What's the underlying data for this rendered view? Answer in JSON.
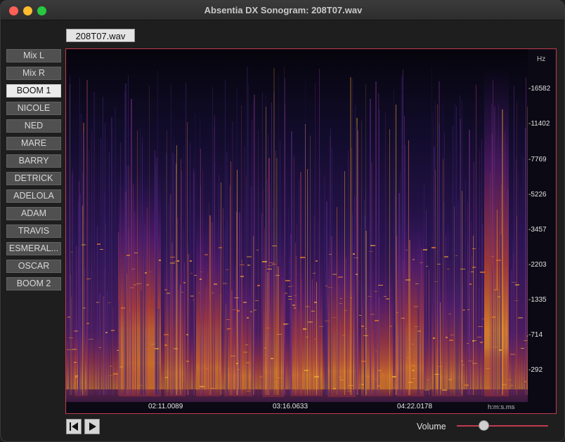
{
  "window": {
    "title": "Absentia DX Sonogram: 208T07.wav"
  },
  "file_tab": {
    "label": "208T07.wav"
  },
  "tracks": [
    {
      "label": "Mix L"
    },
    {
      "label": "Mix R"
    },
    {
      "label": "BOOM 1",
      "selected": true
    },
    {
      "label": "NICOLE"
    },
    {
      "label": "NED"
    },
    {
      "label": "MARE"
    },
    {
      "label": "BARRY"
    },
    {
      "label": "DETRICK"
    },
    {
      "label": "ADELOLA"
    },
    {
      "label": "ADAM"
    },
    {
      "label": "TRAVIS"
    },
    {
      "label": "ESMERAL..."
    },
    {
      "label": "OSCAR"
    },
    {
      "label": "BOOM 2"
    }
  ],
  "freq_axis": {
    "unit": "Hz",
    "ticks": [
      "-16582",
      "-11402",
      "-7769",
      "-5226",
      "-3457",
      "-2203",
      "-1335",
      "-714",
      "-292"
    ]
  },
  "time_axis": {
    "unit": "h:m:s.ms",
    "ticks": [
      "02:11.0089",
      "03:16.0633",
      "04:22.0178"
    ]
  },
  "transport": {
    "start_icon": "skip-to-start-icon",
    "play_icon": "play-icon"
  },
  "volume": {
    "label": "Volume",
    "level": 0.27
  },
  "colors": {
    "accent": "#c23a50",
    "spectro_low": "#1a0f3a",
    "spectro_mid": "#7a1f7a",
    "spectro_high": "#f0a020"
  }
}
